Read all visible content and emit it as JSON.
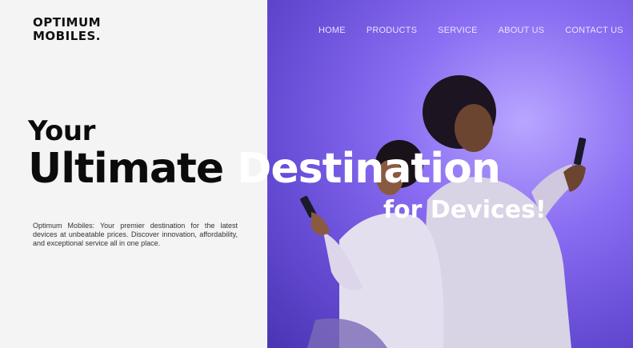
{
  "brand": {
    "line1": "OPTIMUM",
    "line2": "MOBILES."
  },
  "nav": [
    "HOME",
    "PRODUCTS",
    "SERVICE",
    "ABOUT US",
    "CONTACT US"
  ],
  "hero": {
    "line1": "Your",
    "line2_dark": "Ultimate ",
    "line2_light": "Destination",
    "line3": "for Devices!",
    "description": "Optimum Mobiles: Your premier destination for the latest devices at unbeatable prices. Discover innovation, affordability, and exceptional service all in one place."
  },
  "colors": {
    "dark": "#0b0b0b",
    "accent": "#7a5ce6",
    "light": "#ffffff"
  }
}
